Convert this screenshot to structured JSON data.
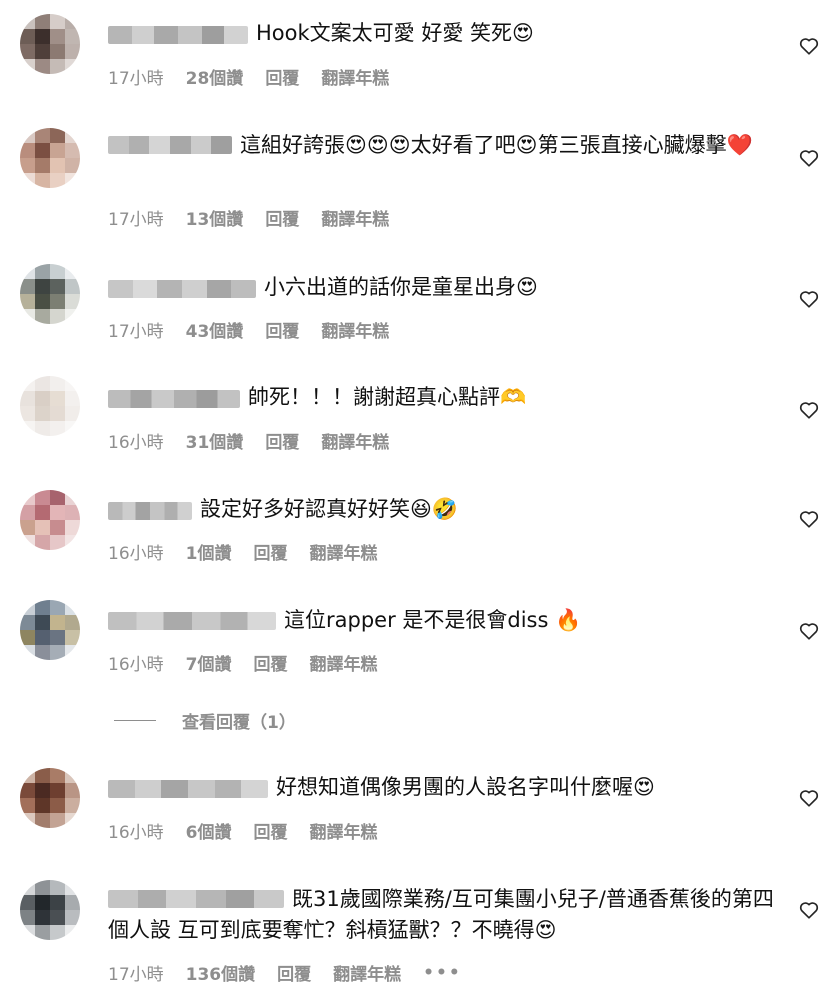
{
  "comments": [
    {
      "text": "Hook文案太可愛 好愛 笑死😍",
      "time": "17小時",
      "likes": "28個讚",
      "reply": "回覆",
      "translate": "翻譯年糕",
      "avatar_colors": [
        "#c9c1bd",
        "#8f7f78",
        "#d6cdc9",
        "#b9aea9",
        "#6d5d56",
        "#3c2f2c",
        "#a08f88",
        "#c0b6b1",
        "#7e6b64",
        "#4f3f3a",
        "#8c7a72",
        "#bdb1ac",
        "#d8d0cc",
        "#9c8a84",
        "#c5bbb6",
        "#e0d9d6"
      ],
      "uname_colors": [
        "#b6b6b6",
        "#cfcfcf",
        "#a9a9a9",
        "#c4c4c4",
        "#9e9e9e",
        "#d2d2d2"
      ],
      "uname_width": 140
    },
    {
      "text": "這組好誇張😍😍😍太好看了吧😍第三張直接心臟爆擊❤️",
      "time": "17小時",
      "likes": "13個讚",
      "reply": "回覆",
      "translate": "翻譯年糕",
      "avatar_colors": [
        "#d9c8c2",
        "#a98577",
        "#8c6658",
        "#e3d5cf",
        "#b98d7d",
        "#7b4f42",
        "#c8a493",
        "#d5bbb0",
        "#c79e8c",
        "#a57b69",
        "#e2c3b2",
        "#d0b3a6",
        "#ecdcd5",
        "#d7b5a3",
        "#e9d0c3",
        "#f1e4de"
      ],
      "uname_colors": [
        "#c2c2c2",
        "#b0b0b0",
        "#d5d5d5",
        "#a8a8a8",
        "#cbcbcb",
        "#9f9f9f"
      ],
      "uname_width": 124
    },
    {
      "text": "小六出道的話你是童星出身😍",
      "time": "17小時",
      "likes": "43個讚",
      "reply": "回覆",
      "translate": "翻譯年糕",
      "avatar_colors": [
        "#dfe3e6",
        "#9aa3a6",
        "#c8cfd1",
        "#e9ecee",
        "#8a8f8a",
        "#3e4441",
        "#5c625e",
        "#c0c6c7",
        "#b6b19a",
        "#4a4f44",
        "#7c7f73",
        "#dadcd7",
        "#e8e9e4",
        "#a8aa9f",
        "#d5d6cf",
        "#f0f1ee"
      ],
      "uname_colors": [
        "#c6c6c6",
        "#dadada",
        "#b4b4b4",
        "#cfcfcf",
        "#a6a6a6",
        "#bdbdbd"
      ],
      "uname_width": 148
    },
    {
      "text": "帥死！！！謝謝超真心點評🫶",
      "time": "16小時",
      "likes": "31個讚",
      "reply": "回覆",
      "translate": "翻譯年糕",
      "avatar_colors": [
        "#f4f1ef",
        "#ebe6e3",
        "#f2efed",
        "#f7f5f4",
        "#e8e2dd",
        "#d9cfc6",
        "#e6ddd3",
        "#f3f0ee",
        "#ece6e1",
        "#dcd3ca",
        "#e4dbd3",
        "#f1edea",
        "#f6f4f2",
        "#efebe8",
        "#f3f0ee",
        "#f8f7f6"
      ],
      "uname_colors": [
        "#bcbcbc",
        "#a4a4a4",
        "#c9c9c9",
        "#b0b0b0",
        "#9c9c9c",
        "#c2c2c2"
      ],
      "uname_width": 132
    },
    {
      "text": "設定好多好認真好好笑😆🤣",
      "time": "16小時",
      "likes": "1個讚",
      "reply": "回覆",
      "translate": "翻譯年糕",
      "avatar_colors": [
        "#e8c9cb",
        "#c98a92",
        "#a7636d",
        "#e9d3d4",
        "#d4a0a5",
        "#b46a72",
        "#e3b5b7",
        "#ddb2b5",
        "#caa18e",
        "#e5c1b7",
        "#c78c8f",
        "#eed9d8",
        "#efe0df",
        "#d5a6a8",
        "#e6c7c8",
        "#f2e4e4"
      ],
      "uname_colors": [
        "#b9b9b9",
        "#cdcdcd",
        "#a3a3a3",
        "#c4c4c4",
        "#afafaf",
        "#d0d0d0"
      ],
      "uname_width": 84
    },
    {
      "text": "這位rapper 是不是很會diss 🔥",
      "time": "16小時",
      "likes": "7個讚",
      "reply": "回覆",
      "translate": "翻譯年糕",
      "avatar_colors": [
        "#c8cfd6",
        "#6f7f8f",
        "#9aa7b3",
        "#dbe1e6",
        "#7d8a96",
        "#3e4a55",
        "#c2b48e",
        "#b1a98e",
        "#8e8560",
        "#556070",
        "#6a7482",
        "#c8c0a5",
        "#d8dde2",
        "#8a8f9a",
        "#a5adb6",
        "#e4e7ea"
      ],
      "uname_colors": [
        "#c0c0c0",
        "#d2d2d2",
        "#aaaaaa",
        "#c8c8c8",
        "#b2b2b2",
        "#d8d8d8"
      ],
      "uname_width": 168
    },
    {
      "text": "好想知道偶像男團的人設名字叫什麼喔😍",
      "time": "16小時",
      "likes": "6個讚",
      "reply": "回覆",
      "translate": "翻譯年糕",
      "avatar_colors": [
        "#cdb3a5",
        "#8a5d4a",
        "#a97c67",
        "#d9c5ba",
        "#7a4a3a",
        "#4b2a22",
        "#6e3f30",
        "#b99585",
        "#a26f5a",
        "#5e3628",
        "#8c5c48",
        "#cbae9f",
        "#dcc9bf",
        "#a27d6c",
        "#c3a394",
        "#e6d8d0"
      ],
      "uname_colors": [
        "#bababa",
        "#cecece",
        "#a5a5a5",
        "#c7c7c7",
        "#b3b3b3",
        "#d4d4d4"
      ],
      "uname_width": 160
    },
    {
      "text": "既31歲國際業務/互可集團小兒子/普通香蕉後的第四個人設 互可到底要奪忙？斜槓猛獸？？不曉得😍",
      "time": "17小時",
      "likes": "136個讚",
      "reply": "回覆",
      "translate": "翻譯年糕",
      "more": "•••",
      "avatar_colors": [
        "#d4d6d8",
        "#8e9296",
        "#b5b9bc",
        "#e1e3e5",
        "#5a5f63",
        "#22272b",
        "#3c4246",
        "#a7abae",
        "#7d8285",
        "#2e3338",
        "#4a4f53",
        "#b9bcbf",
        "#dadcde",
        "#9a9ea1",
        "#c6c9cb",
        "#ebeced"
      ],
      "uname_colors": [
        "#c4c4c4",
        "#adadad",
        "#d0d0d0",
        "#b6b6b6",
        "#a0a0a0",
        "#c9c9c9"
      ],
      "uname_width": 176
    }
  ],
  "view_replies": "查看回覆（1）"
}
